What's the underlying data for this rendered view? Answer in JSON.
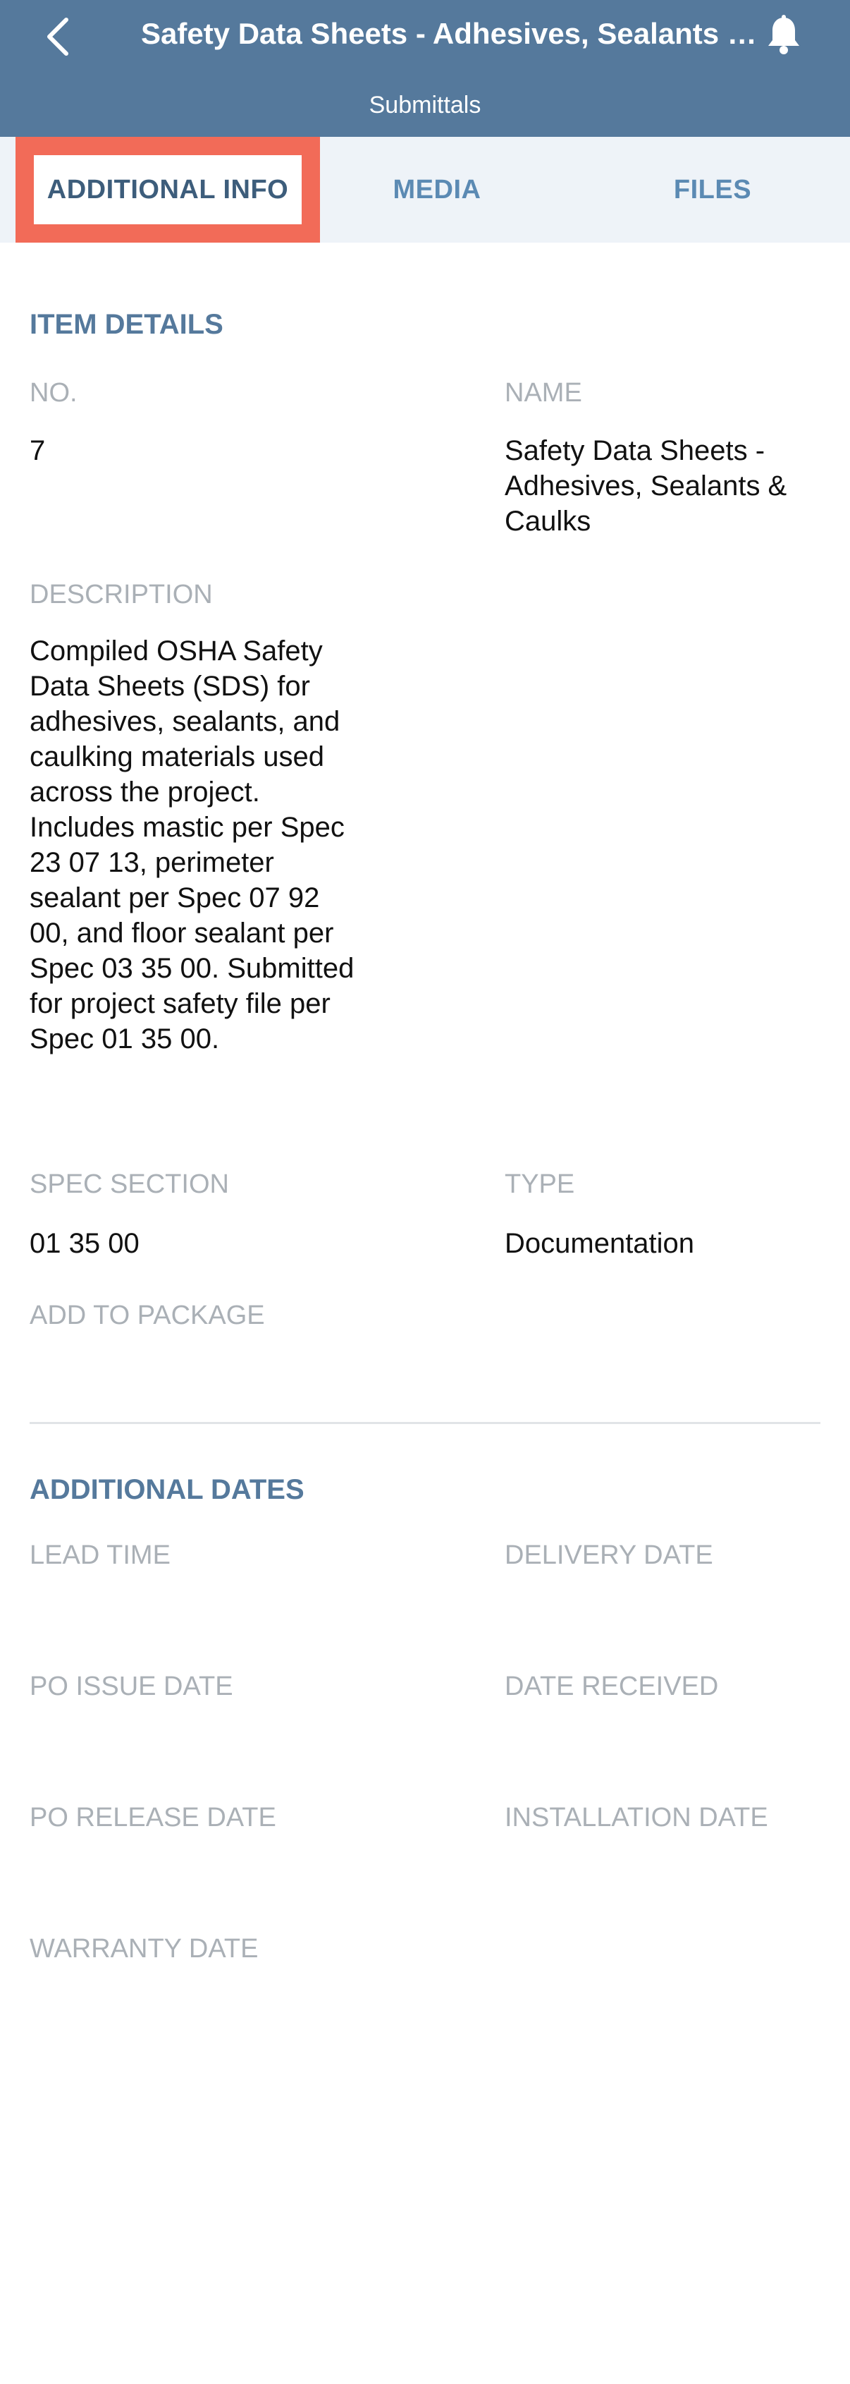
{
  "header": {
    "title": "Safety Data Sheets - Adhesives, Sealants & Caulks",
    "subtitle": "Submittals",
    "background": "#55799c"
  },
  "tabs": [
    {
      "label": "ADDITIONAL INFO",
      "active": true
    },
    {
      "label": "MEDIA",
      "active": false
    },
    {
      "label": "FILES",
      "active": false
    }
  ],
  "item_details": {
    "title": "ITEM DETAILS",
    "no_label": "NO.",
    "no_value": "7",
    "name_label": "NAME",
    "name_value": "Safety Data Sheets - Adhesives, Sealants & Caulks",
    "description_label": "DESCRIPTION",
    "description_value": "Compiled OSHA Safety Data Sheets (SDS) for adhesives, sealants, and caulking materials used across the project. Includes mastic per Spec 23 07 13, perimeter sealant per Spec 07 92 00, and floor sealant per Spec 03 35 00. Submitted for project safety file per Spec 01 35 00.",
    "spec_section_label": "SPEC SECTION",
    "spec_section_value": "01 35 00",
    "type_label": "TYPE",
    "type_value": "Documentation",
    "add_to_package_label": "ADD TO PACKAGE"
  },
  "additional_dates": {
    "title": "ADDITIONAL DATES",
    "lead_time_label": "LEAD TIME",
    "delivery_date_label": "DELIVERY DATE",
    "po_issue_date_label": "PO ISSUE DATE",
    "date_received_label": "DATE RECEIVED",
    "po_release_date_label": "PO RELEASE DATE",
    "installation_date_label": "INSTALLATION DATE",
    "warranty_date_label": "WARRANTY DATE"
  },
  "icons": {
    "back": "chevron-left-icon",
    "notifications": "bell-icon"
  },
  "colors": {
    "header": "#55799c",
    "tab_active_highlight": "#f26b58",
    "tab_text": "#5b8ab3",
    "section_title": "#55799c",
    "label": "#aab0b6"
  }
}
